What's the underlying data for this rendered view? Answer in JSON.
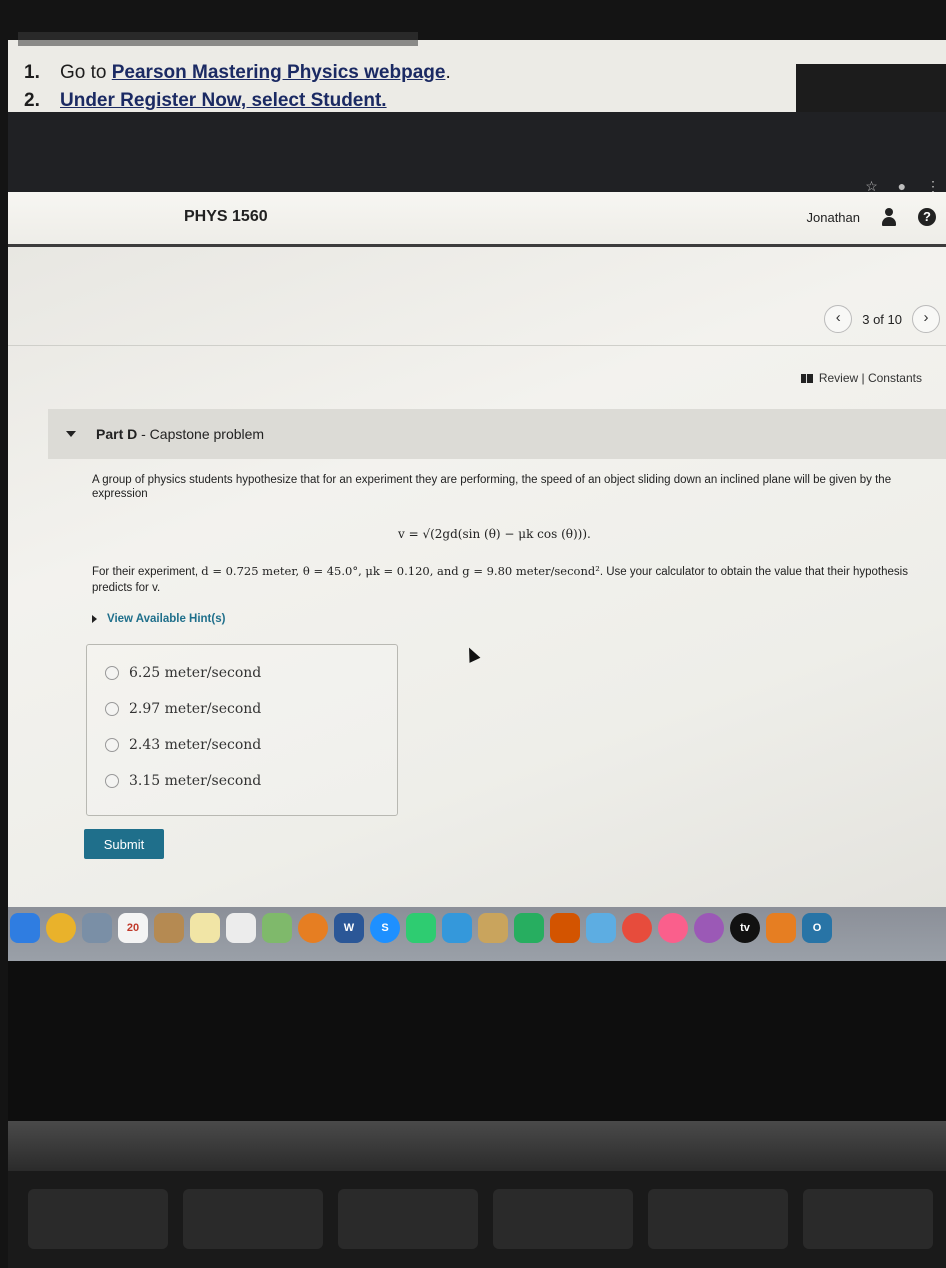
{
  "document": {
    "lines": [
      {
        "number": "1.",
        "prefix": "Go to ",
        "link": "Pearson Mastering Physics webpage",
        "suffix": "."
      },
      {
        "number": "2.",
        "prefix": "",
        "link": "Under Register Now, select Student.",
        "suffix": ""
      }
    ]
  },
  "header": {
    "course_title": "PHYS 1560",
    "user_name": "Jonathan",
    "help_glyph": "?"
  },
  "pager": {
    "prev_glyph": "‹",
    "next_glyph": "›",
    "position": "3 of 10"
  },
  "review_link": "Review | Constants",
  "part": {
    "label_bold": "Part D",
    "label_rest": " - Capstone problem"
  },
  "question": {
    "text": "A group of physics students hypothesize that for an experiment they are performing, the speed of an object sliding down an inclined plane will be given by the expression",
    "equation": "v = √(2gd(sin (θ) − μk cos (θ))).",
    "given_prefix": "For their experiment, ",
    "given_values": "d = 0.725 meter, θ = 45.0°, μk = 0.120, and g = 9.80 meter/second²",
    "given_suffix": ". Use your calculator to obtain the value that their hypothesis predicts for v."
  },
  "hints_label": "View Available Hint(s)",
  "options": [
    "6.25 meter/second",
    "2.97 meter/second",
    "2.43 meter/second",
    "3.15 meter/second"
  ],
  "submit_label": "Submit",
  "dock": {
    "calendar_day": "20",
    "tv_label": "tv",
    "word_label": "W",
    "skype_label": "S",
    "outlook_label": "O"
  },
  "colors": {
    "accent": "#1f6f8b",
    "header_rule": "#3c3c3c",
    "part_background": "#dcdbd6"
  }
}
